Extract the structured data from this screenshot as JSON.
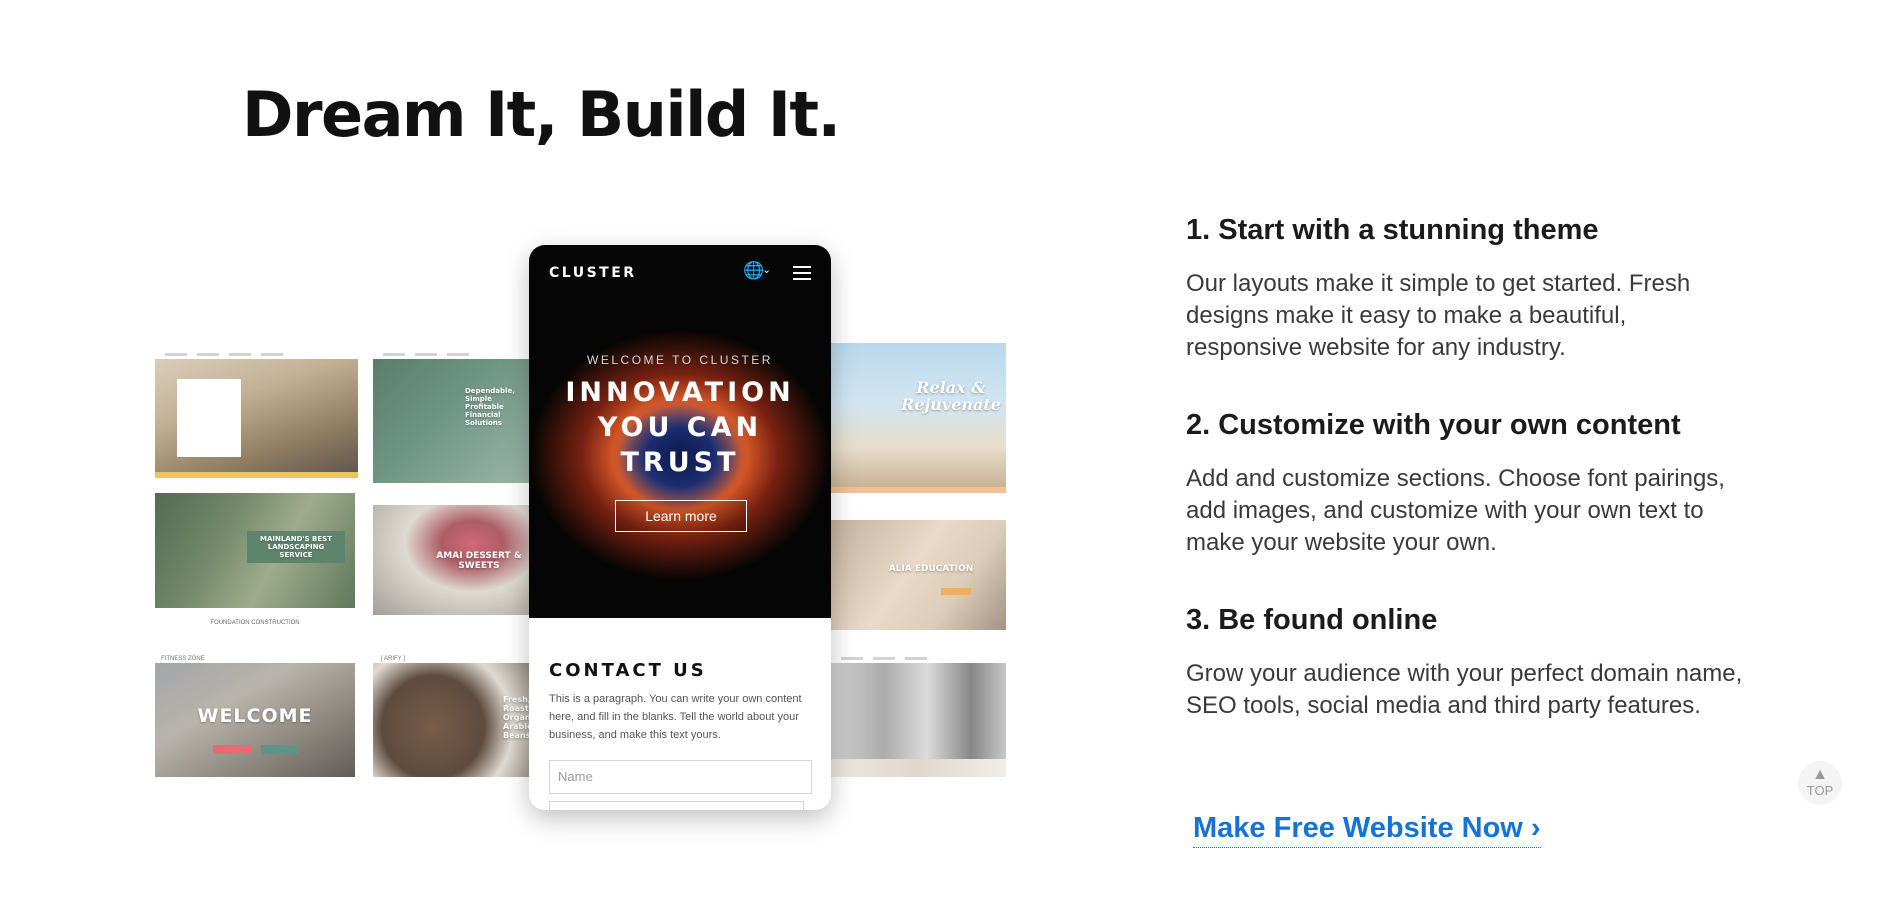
{
  "headline": "Dream It, Build It.",
  "showcase": {
    "phone": {
      "brand": "CLUSTER",
      "eyebrow": "WELCOME TO CLUSTER",
      "title_lines": [
        "INNOVATION",
        "YOU CAN",
        "TRUST"
      ],
      "button_label": "Learn more",
      "contact_heading": "CONTACT US",
      "contact_paragraph": "This is a paragraph. You can write your own content here, and fill in the blanks. Tell the world about your business, and make this text yours.",
      "name_placeholder": "Name"
    },
    "tiles": {
      "landscaping": "MAINLAND'S BEST LANDSCAPING SERVICE",
      "construction": "FOUNDATION CONSTRUCTION",
      "fitness_brand": "FITNESS ZONE",
      "welcome": "WELCOME",
      "dessert": "AMAI DESSERT & SWEETS",
      "financial": "Dependable, Simple Profitable Financial Solutions",
      "coffee_brand": "[ ARIFY ]",
      "coffee_text": "Fresh, Roasted Organic Arabica Beans",
      "spa": "Relax & Rejuvenate",
      "education": "ALIA EDUCATION"
    }
  },
  "features": [
    {
      "title": "1. Start with a stunning theme",
      "description": "Our layouts make it simple to get started. Fresh designs make it easy to make a beautiful, responsive website for any industry."
    },
    {
      "title": "2. Customize with your own content",
      "description": "Add and customize sections. Choose font pairings, add images, and customize with your own text to make your website your own."
    },
    {
      "title": "3. Be found online",
      "description": "Grow your audience with your perfect domain name, SEO tools, social media and third party features."
    }
  ],
  "cta": {
    "label": "Make Free Website Now",
    "chevron": "›"
  },
  "to_top": {
    "label": "TOP",
    "icon": "arrow-up-icon"
  },
  "colors": {
    "accent": "#1473d6",
    "text": "#1b1b1b"
  }
}
